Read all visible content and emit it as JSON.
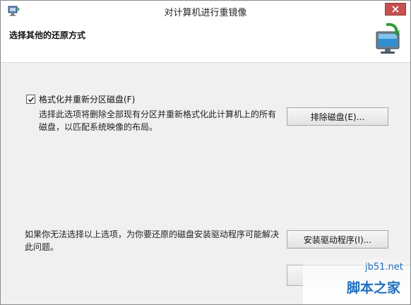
{
  "window": {
    "title": "对计算机进行重镜像",
    "close_icon": "close-icon"
  },
  "header": {
    "title": "选择其他的还原方式",
    "icon": "computer-restore-icon"
  },
  "format_option": {
    "checkbox_label": "格式化并重新分区磁盘(F)",
    "checked": true,
    "description": "选择此选项将删除全部现有分区并重新格式化此计算机上的所有磁盘，以匹配系统映像的布局。",
    "button_label": "排除磁盘(E)..."
  },
  "driver_option": {
    "description": "如果你无法选择以上选项，为你要还原的磁盘安装驱动程序可能解决此问题。",
    "button_label": "安装驱动程序(I)..."
  },
  "watermark": {
    "site": "jb51.net",
    "name": "脚本之家"
  },
  "colors": {
    "close_button": "#c75050",
    "watermark": "#1f6fbf"
  }
}
